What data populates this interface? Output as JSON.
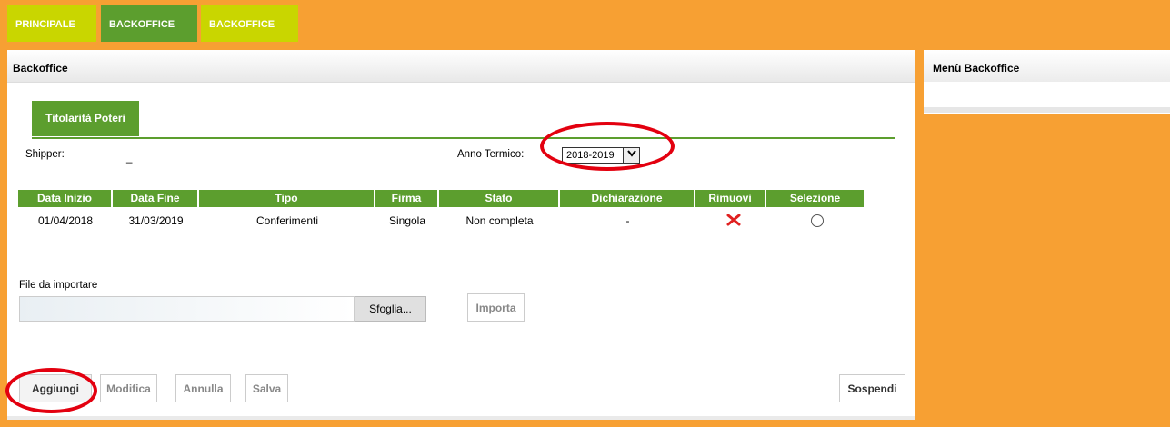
{
  "top_tabs": [
    {
      "label": "PRINCIPALE"
    },
    {
      "label": "BACKOFFICE"
    },
    {
      "label": "BACKOFFICE"
    }
  ],
  "main": {
    "title": "Backoffice",
    "subtab": "Titolarità Poteri",
    "shipper_label": "Shipper:",
    "shipper_value": "_",
    "anno_label": "Anno Termico:",
    "anno_value": "2018-2019"
  },
  "table": {
    "headers": [
      "Data Inizio",
      "Data Fine",
      "Tipo",
      "Firma",
      "Stato",
      "Dichiarazione",
      "Rimuovi",
      "Selezione"
    ],
    "rows": [
      {
        "data_inizio": "01/04/2018",
        "data_fine": "31/03/2019",
        "tipo": "Conferimenti",
        "firma": "Singola",
        "stato": "Non completa",
        "dichiarazione": "-"
      }
    ]
  },
  "file": {
    "label": "File da importare",
    "browse": "Sfoglia...",
    "import": "Importa"
  },
  "actions": {
    "add": "Aggiungi",
    "edit": "Modifica",
    "cancel": "Annulla",
    "save": "Salva",
    "suspend": "Sospendi"
  },
  "side": {
    "title": "Menù Backoffice"
  },
  "colors": {
    "background_orange": "#f7a033",
    "tab_yellow": "#c9d600",
    "green": "#5c9e2e",
    "annotation_red": "#e3000f"
  },
  "icons": {
    "remove": "red-x-icon",
    "select": "radio-icon",
    "dropdown": "chevron-down-icon"
  }
}
